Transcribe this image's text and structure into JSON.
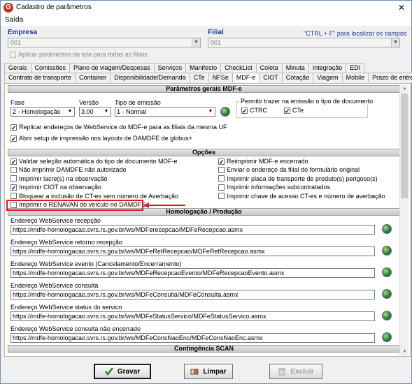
{
  "window": {
    "title": "Cadastro de parâmetros",
    "close": "✕"
  },
  "menu": {
    "saida": "Saída"
  },
  "header": {
    "empresa_label": "Empresa",
    "empresa_value": "001",
    "filial_label": "Filial",
    "filial_value": "001",
    "hint": "\"CTRL + F\" para localizar os campos",
    "aplicar": "Aplicar parâmetros da tela para todas as filiais"
  },
  "tabs_row1": [
    "Gerais",
    "Comissões",
    "Plano de viagem/Despesas",
    "Serviços",
    "Manifesto",
    "CheckList",
    "Coleta",
    "Minuta",
    "Integração",
    "EDI"
  ],
  "tabs_row2": [
    "Contrato de transporte",
    "Container",
    "Disponibilidade/Demanda",
    "CTe",
    "NFSe",
    "MDF-e",
    "CIOT",
    "Cotação",
    "Viagem",
    "Mobile",
    "Prazo de entrega"
  ],
  "geral": {
    "section": "Parâmetros gerais MDF-e",
    "fase_label": "Fase",
    "fase_value": "2 - Homologação",
    "versao_label": "Versão",
    "versao_value": "3.00",
    "tipo_label": "Tipo de emissão",
    "tipo_value": "1 - Normal",
    "permitir_label": "Permitir trazer na emissão o tipo de documento",
    "ctrc": "CTRC",
    "cte": "CTe",
    "replicar": "Replicar endereços de WebService do MDF-e para as filiais da mesma UF",
    "abrir": "Abrir setup de impressão nos layouts de DAMDFE de globus+"
  },
  "opcoes": {
    "section": "Opções",
    "left": [
      {
        "label": "Validar seleção automática do tipo de documento MDF-e",
        "checked": true
      },
      {
        "label": "Não imprimir DAMDFE não autorizado",
        "checked": false
      },
      {
        "label": "Imprimir lacre(s) na observação",
        "checked": false
      },
      {
        "label": "Imprimir CIOT na observação",
        "checked": true
      },
      {
        "label": "Bloquear a inclusão de CT-es sem número de Averbação",
        "checked": false
      },
      {
        "label": "Imprimir o RENAVAN do veículo no DAMDFE",
        "checked": false
      }
    ],
    "right": [
      {
        "label": "Reimprimir MDF-e encerrado",
        "checked": true
      },
      {
        "label": "Enviar o endereço da filial do formulário original",
        "checked": false
      },
      {
        "label": "Imprimir placa de transporte de produto(s) perigoso(s)",
        "checked": false
      },
      {
        "label": "Imprimir informações subcontratados",
        "checked": false
      },
      {
        "label": "Imprimir chave de acesso CT-es e número de averbação",
        "checked": false
      }
    ]
  },
  "homolog": {
    "section": "Homologação / Produção",
    "items": [
      {
        "label": "Endereço WebService recepção",
        "value": "https://mdfe-homologacao.svrs.rs.gov.br/ws/MDFerecepcao/MDFeRecepcao.asmx"
      },
      {
        "label": "Endereço WebService retorno recepção",
        "value": "https://mdfe-homologacao.svrs.rs.gov.br/ws/MDFeRetRecepcao/MDFeRetRecepcao.asmx"
      },
      {
        "label": "Endereço WebService evento (Cancelamento/Encerramento)",
        "value": "https://mdfe-homologacao.svrs.rs.gov.br/ws/MDFeRecepcaoEvento/MDFeRecepcaoEvento.asmx"
      },
      {
        "label": "Endereço WebService consulta",
        "value": "https://mdfe-homologacao.svrs.rs.gov.br/ws/MDFeConsulta/MDFeConsulta.asmx"
      },
      {
        "label": "Endereço WebService status do servico",
        "value": "https://mdfe-homologacao.svrs.rs.gov.br/ws/MDFeStatusServico/MDFeStatusServico.asmx"
      },
      {
        "label": "Endereço WebService consulta não encerrado",
        "value": "https://mdfe-homologacao.svrs.rs.gov.br/ws/MDFeConsNaoEnc/MDFeConsNaoEnc.asmx"
      }
    ]
  },
  "contingencia": {
    "section": "Contingência SCAN"
  },
  "buttons": {
    "gravar": "Gravar",
    "limpar": "Limpar",
    "excluir": "Excluir"
  }
}
